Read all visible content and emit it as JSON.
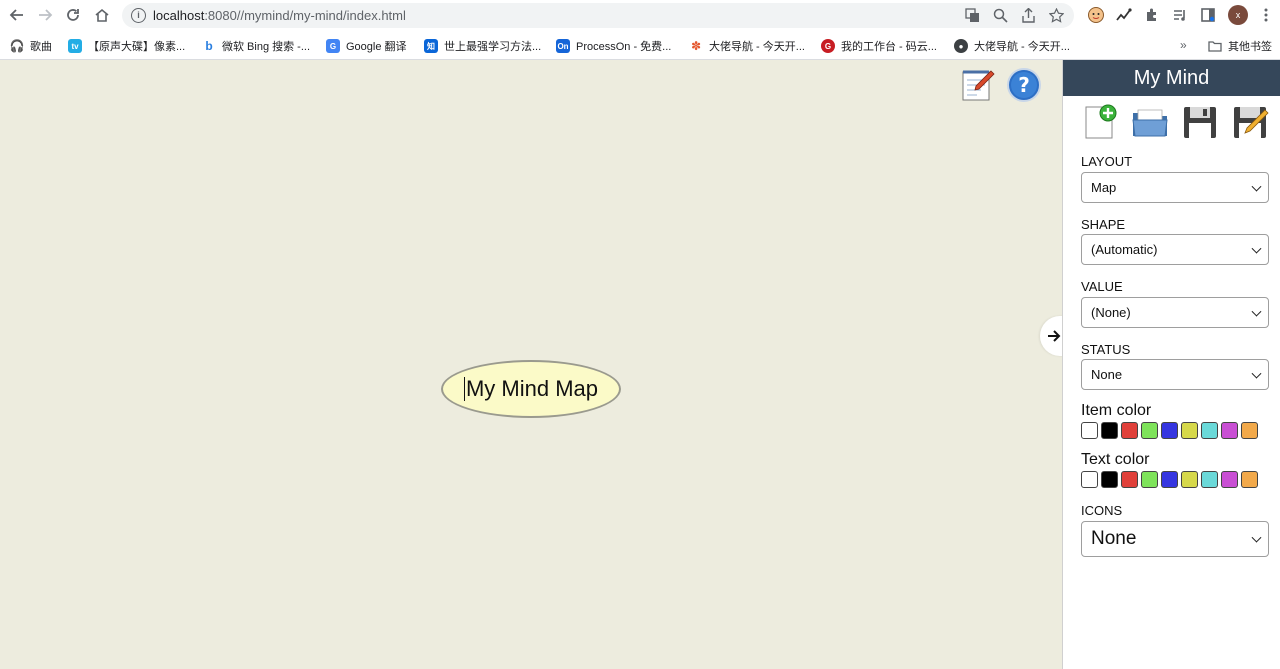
{
  "browser": {
    "url_host": "localhost",
    "url_rest": ":8080//mymind/my-mind/index.html",
    "avatar_letter": "x"
  },
  "bookmarks": [
    {
      "label": "歌曲",
      "icon": "headphones-icon",
      "color": "#1a73e8"
    },
    {
      "label": "【原声大碟】像素...",
      "icon": "bilibili-icon",
      "color": "#23ade5"
    },
    {
      "label": "微软 Bing 搜索 -...",
      "icon": "bing-icon",
      "color": "#2a7fe0"
    },
    {
      "label": "Google 翻译",
      "icon": "google-translate-icon",
      "color": "#4285f4"
    },
    {
      "label": "世上最强学习方法...",
      "icon": "zhihu-icon",
      "color": "#0a66d8"
    },
    {
      "label": "ProcessOn - 免费...",
      "icon": "processon-icon",
      "color": "#1565d8"
    },
    {
      "label": "大佬导航 - 今天开...",
      "icon": "bird-icon",
      "color": "#e4572e"
    },
    {
      "label": "我的工作台 - 码云...",
      "icon": "gitee-icon",
      "color": "#c71d23"
    },
    {
      "label": "大佬导航 - 今天开...",
      "icon": "globe-icon",
      "color": "#3c4043"
    }
  ],
  "bookmarks_more": "»",
  "bookmarks_folder": "其他书签",
  "canvas": {
    "root_node_text": "My Mind Map",
    "background": "#edecde",
    "node_fill": "#fbfac8"
  },
  "panel": {
    "title": "My Mind",
    "header_color": "#35475a",
    "layout_label": "LAYOUT",
    "layout_value": "Map",
    "shape_label": "SHAPE",
    "shape_value": "(Automatic)",
    "value_label": "VALUE",
    "value_value": "(None)",
    "status_label": "STATUS",
    "status_value": "None",
    "item_color_label": "Item color",
    "text_color_label": "Text color",
    "icons_label": "ICONS",
    "icons_value": "None",
    "palette": [
      "#ffffff",
      "#000000",
      "#e0403a",
      "#7ee35a",
      "#3535e0",
      "#d6d84a",
      "#6ad9d9",
      "#c94fd4",
      "#f2a94a"
    ]
  }
}
